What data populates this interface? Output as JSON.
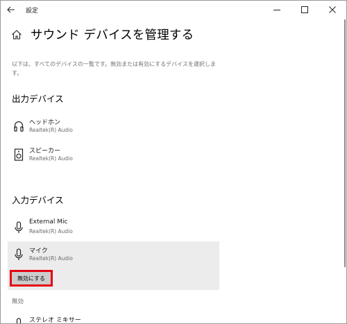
{
  "titlebar": {
    "app_title": "設定",
    "back_icon": "back-arrow-icon",
    "controls": [
      "minimize-icon",
      "maximize-icon",
      "close-icon"
    ]
  },
  "header": {
    "icon": "home-icon",
    "title": "サウンド デバイスを管理する"
  },
  "description": "以下は、すべてのデバイスの一覧です。無効または有効にするデバイスを選択します。",
  "output": {
    "heading": "出力デバイス",
    "devices": [
      {
        "name": "ヘッドホン",
        "driver": "Realtek(R) Audio",
        "icon": "headphones-icon"
      },
      {
        "name": "スピーカー",
        "driver": "Realtek(R) Audio",
        "icon": "speaker-icon"
      }
    ]
  },
  "input": {
    "heading": "入力デバイス",
    "devices": [
      {
        "name": "External Mic",
        "driver": "Realtek(R) Audio",
        "icon": "microphone-icon"
      },
      {
        "name": "マイク",
        "driver": "Realtek(R) Audio",
        "icon": "microphone-icon",
        "selected": true,
        "button": "無効にする"
      }
    ]
  },
  "disabled": {
    "label": "無効",
    "devices": [
      {
        "name": "ステレオ ミキサー",
        "icon": "microphone-icon"
      }
    ]
  },
  "colors": {
    "highlight_border": "#e60012",
    "selected_bg": "#ececec",
    "button_bg": "#cccccc",
    "secondary_text": "#707070"
  }
}
